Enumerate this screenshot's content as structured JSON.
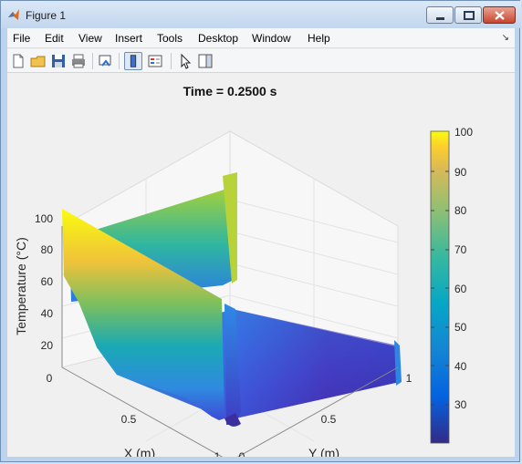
{
  "window": {
    "title": "Figure 1"
  },
  "menu": [
    "File",
    "Edit",
    "View",
    "Insert",
    "Tools",
    "Desktop",
    "Window",
    "Help"
  ],
  "toolbar_icons": [
    "new-figure-icon",
    "open-file-icon",
    "save-icon",
    "print-icon",
    "link-plot-icon",
    "colorbar-toggle-icon",
    "legend-toggle-icon",
    "pointer-icon",
    "property-editor-icon"
  ],
  "plot": {
    "title": "Time = 0.2500 s",
    "zlabel": "Temperature (°C)",
    "xlabel": "X (m)",
    "ylabel": "Y (m)",
    "z_ticks": [
      "20",
      "40",
      "60",
      "80",
      "100"
    ],
    "x_ticks": [
      "0",
      "0.5",
      "1"
    ],
    "y_ticks": [
      "0",
      "0.5",
      "1"
    ],
    "colormap": "parula"
  },
  "colorbar": {
    "ticks": [
      "30",
      "40",
      "50",
      "60",
      "70",
      "80",
      "90",
      "100"
    ],
    "range": [
      20,
      100
    ]
  }
}
